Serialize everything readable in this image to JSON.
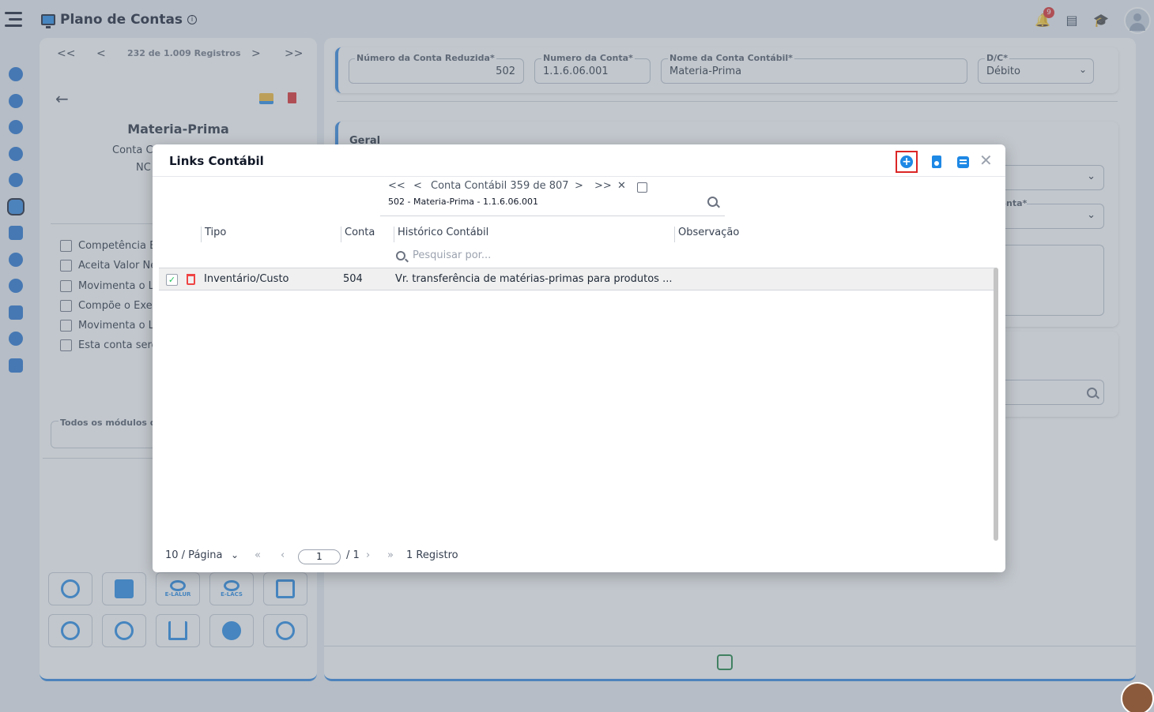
{
  "app": {
    "title": "Plano de Contas",
    "notifications": "9"
  },
  "left_panel": {
    "nav_first": "<<",
    "nav_prev": "<",
    "nav_next": ">",
    "nav_last": ">>",
    "record_counter": "232 de 1.009 Registros",
    "title": "Materia-Prima",
    "subtitle_1": "Conta C",
    "subtitle_2": "NC",
    "checkboxes": [
      "Competência E",
      "Aceita Valor Ne",
      "Movimenta o Li",
      "Compõe o Exer",
      "Movimenta o Li",
      "Esta conta serc"
    ],
    "modules_legend": "Todos os módulos di",
    "tool_labels": [
      "",
      "",
      "E-LALUR",
      "E-LACS",
      "",
      "",
      "",
      "",
      "",
      ""
    ]
  },
  "form": {
    "reduced_account_label": "Número da Conta Reduzida*",
    "reduced_account_value": "502",
    "account_number_label": "Numero da Conta*",
    "account_number_value": "1.1.6.06.001",
    "account_name_label": "Nome da Conta Contábil*",
    "account_name_value": "Materia-Prima",
    "dc_label": "D/C*",
    "dc_value": "Débito",
    "section_general": "Geral",
    "partial_label": "nta*"
  },
  "modal": {
    "title": "Links Contábil",
    "pager": {
      "first": "<<",
      "prev": "<",
      "label": "Conta Contábil 359 de 807",
      "next": ">",
      "last": ">>",
      "clear": "✕"
    },
    "breadcrumb": "502 - Materia-Prima - 1.1.6.06.001",
    "columns": [
      "Tipo",
      "Conta",
      "Histórico Contábil",
      "Observação"
    ],
    "filter_placeholder": "Pesquisar por...",
    "rows": [
      {
        "tipo": "Inventário/Custo",
        "conta": "504",
        "historico": "Vr. transferência de matérias-primas para produtos ...",
        "observacao": ""
      }
    ],
    "footer": {
      "page_size": "10 / Página",
      "page_current": "1",
      "page_total": "/ 1",
      "total_records": "1 Registro"
    }
  }
}
